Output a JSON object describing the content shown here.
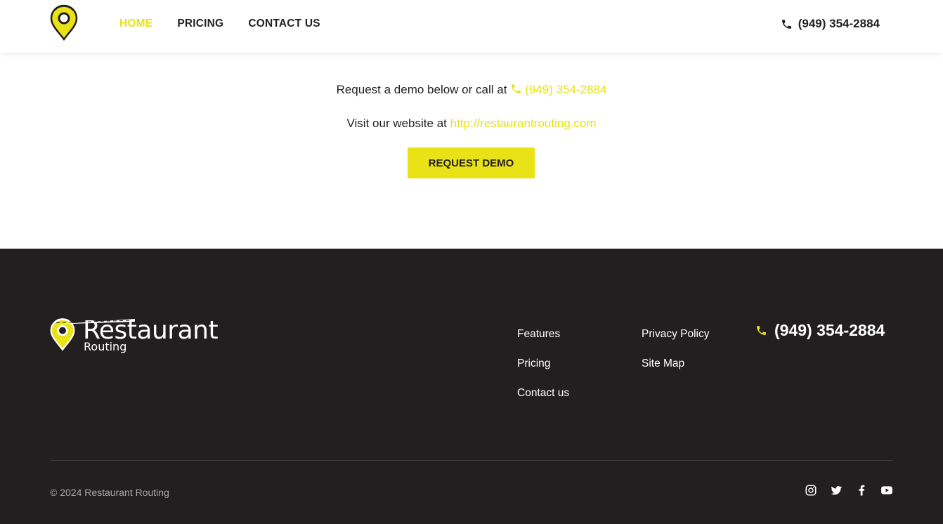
{
  "header": {
    "nav": [
      {
        "label": "HOME",
        "active": true
      },
      {
        "label": "PRICING",
        "active": false
      },
      {
        "label": "CONTACT US",
        "active": false
      }
    ],
    "phone": "(949) 354-2884"
  },
  "main": {
    "demo_text": "Request a demo below or call at",
    "demo_phone": "(949) 354-2884",
    "website_text": "Visit our website at",
    "website_url": "http://restaurantrouting.com",
    "button_label": "REQUEST DEMO"
  },
  "footer": {
    "brand": "Restaurant",
    "brand_sub": "Routing",
    "col1": [
      "Features",
      "Pricing",
      "Contact us"
    ],
    "col2": [
      "Privacy Policy",
      "Site Map"
    ],
    "phone": "(949) 354-2884",
    "copyright": "© 2024 Restaurant Routing",
    "socials": [
      "instagram-icon",
      "twitter-icon",
      "facebook-icon",
      "youtube-icon"
    ]
  },
  "colors": {
    "accent": "#e8e217",
    "dark": "#231f20",
    "footer_bg": "#231f20"
  }
}
